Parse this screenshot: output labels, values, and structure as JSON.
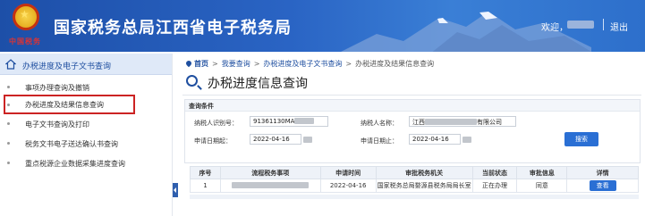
{
  "header": {
    "title": "国家税务总局江西省电子税务局",
    "sub_logo": "中国税务",
    "welcome": "欢迎，",
    "logout": "退出"
  },
  "sidebar": {
    "head": "办税进度及电子文书查询",
    "items": [
      {
        "label": "事项办理查询及撤销"
      },
      {
        "label": "办税进度及结果信息查询"
      },
      {
        "label": "电子文书查询及打印"
      },
      {
        "label": "税务文书电子送达确认书查询"
      },
      {
        "label": "重点税源企业数据采集进度查询"
      }
    ]
  },
  "breadcrumb": {
    "home": "首页",
    "items": [
      "我要查询",
      "办税进度及电子文书查询",
      "办税进度及结果信息查询"
    ]
  },
  "page": {
    "title": "办税进度信息查询"
  },
  "query": {
    "head": "查询条件",
    "taxpayer_id_label": "纳税人识别号：",
    "taxpayer_id_value": "91361130MA",
    "taxpayer_name_label": "纳税人名称：",
    "taxpayer_name_prefix": "江西",
    "taxpayer_name_suffix": "有限公司",
    "date_start_label": "申请日期起：",
    "date_start_value": "2022-04-16",
    "date_end_label": "申请日期止：",
    "date_end_value": "2022-04-16",
    "search_button": "搜索"
  },
  "table": {
    "headers": [
      "序号",
      "流程税务事项",
      "申请时间",
      "审批税务机关",
      "当前状态",
      "审批信息",
      "详情"
    ],
    "rows": [
      {
        "index": "1",
        "date": "2022-04-16",
        "authority": "国家税务总局婺源县税务局局长室",
        "status": "正在办理",
        "approval": "同意",
        "detail": "查看"
      }
    ]
  },
  "colors": {
    "header_blue": "#2a64c4",
    "accent_blue": "#1f4fa0",
    "button_blue": "#2a6fd4",
    "highlight_red": "#cc2323"
  }
}
